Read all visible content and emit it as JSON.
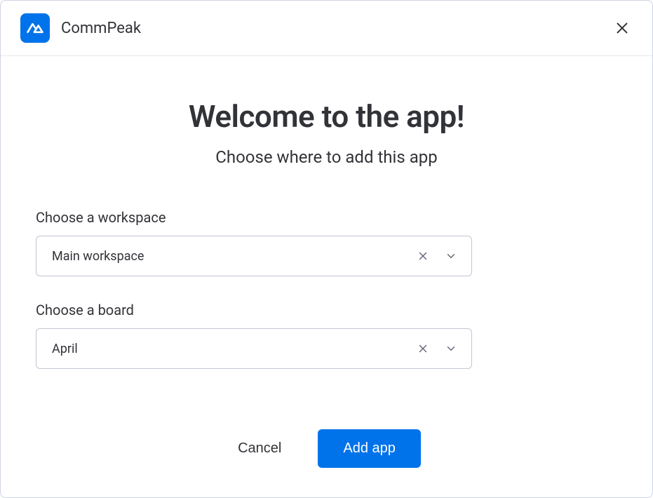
{
  "header": {
    "app_name": "CommPeak"
  },
  "content": {
    "title": "Welcome to the app!",
    "subtitle": "Choose where to add this app",
    "workspace": {
      "label": "Choose a workspace",
      "value": "Main workspace"
    },
    "board": {
      "label": "Choose a board",
      "value": "April"
    }
  },
  "footer": {
    "cancel_label": "Cancel",
    "add_label": "Add app"
  }
}
